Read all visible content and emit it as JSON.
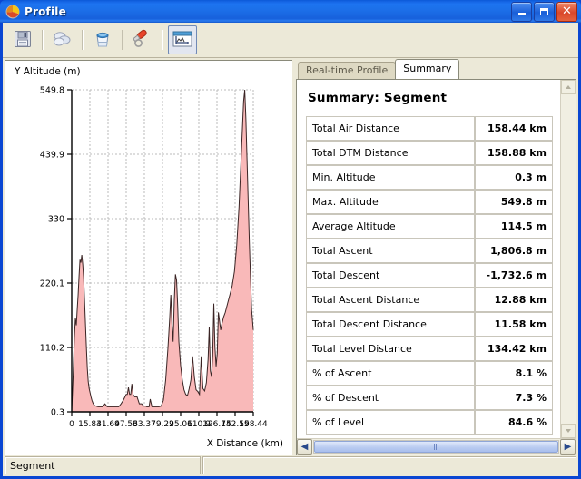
{
  "window": {
    "title": "Profile",
    "icon": "profile-app-icon",
    "caption_buttons": [
      {
        "name": "minimize",
        "glyph": "_"
      },
      {
        "name": "maximize",
        "glyph": "□"
      },
      {
        "name": "close",
        "glyph": "✕"
      }
    ]
  },
  "toolbar": {
    "buttons": [
      {
        "name": "save-icon",
        "tip": "Save"
      },
      {
        "name": "copy-icon",
        "tip": "Copy"
      },
      {
        "name": "paste-bucket-icon",
        "tip": "Paste"
      },
      {
        "name": "eraser-icon",
        "tip": "Erase"
      },
      {
        "name": "profile-chart-icon",
        "tip": "Profile",
        "selected": true
      }
    ]
  },
  "chart_data": {
    "type": "area",
    "title": "",
    "xlabel": "X Distance (km)",
    "ylabel": "Y Altitude (m)",
    "xlim": [
      0,
      158.44
    ],
    "ylim": [
      0.3,
      549.8
    ],
    "grid": true,
    "legend": "none",
    "fill_color": "#f9b9b9",
    "line_color": "#3a2424",
    "y_ticks": [
      "549.8",
      "439.9",
      "330",
      "220.1",
      "110.2",
      "0.3"
    ],
    "y_tick_values": [
      549.8,
      439.9,
      330,
      220.1,
      110.2,
      0.3
    ],
    "x_ticks": [
      "0",
      "15.84",
      "31.69",
      "47.53",
      "63.37",
      "79.22",
      "95.06",
      "110.9",
      "126.75",
      "142.59",
      "158.44"
    ],
    "x_tick_values": [
      0,
      15.84,
      31.69,
      47.53,
      63.37,
      79.22,
      95.06,
      110.9,
      126.75,
      142.59,
      158.44
    ],
    "x": [
      0,
      1.2,
      2.4,
      3.2,
      4.0,
      4.8,
      5.6,
      6.4,
      7.2,
      8.0,
      8.8,
      9.6,
      10.4,
      11.2,
      12.0,
      12.8,
      13.6,
      14.4,
      15.2,
      16.0,
      16.8,
      17.6,
      18.4,
      19.2,
      20.0,
      21.5,
      23.0,
      25.0,
      27.0,
      29.0,
      31.0,
      33.0,
      35.0,
      37.0,
      39.0,
      41.0,
      43.0,
      45.0,
      46.5,
      47.5,
      48.5,
      49.5,
      50.5,
      51.5,
      52.5,
      53.5,
      55.0,
      57.0,
      59.0,
      61.0,
      63.0,
      64.5,
      65.5,
      66.5,
      67.5,
      68.5,
      70.0,
      72.0,
      74.0,
      76.0,
      78.0,
      80.0,
      82.0,
      84.0,
      85.5,
      86.5,
      87.5,
      88.5,
      89.5,
      90.5,
      91.5,
      92.5,
      93.5,
      95.0,
      96.5,
      98.0,
      99.5,
      101.0,
      102.5,
      104.0,
      105.5,
      107.0,
      108.5,
      110.0,
      111.5,
      113.0,
      114.5,
      116.0,
      117.5,
      119.0,
      120.0,
      121.0,
      122.0,
      123.0,
      124.0,
      125.0,
      126.0,
      127.0,
      128.0,
      129.0,
      130.0,
      131.0,
      132.5,
      134.0,
      136.0,
      138.0,
      140.0,
      142.0,
      144.0,
      146.0,
      148.0,
      150.0,
      151.0,
      152.0,
      153.0,
      154.0,
      155.0,
      156.0,
      157.0,
      158.44
    ],
    "y": [
      0.3,
      60,
      130,
      160,
      148,
      175,
      200,
      232,
      260,
      255,
      268,
      252,
      230,
      190,
      150,
      110,
      75,
      52,
      40,
      33,
      26,
      20,
      16,
      13,
      11,
      10,
      9,
      9,
      9,
      14,
      9,
      9,
      9,
      9,
      9,
      9,
      14,
      20,
      26,
      30,
      30,
      42,
      30,
      30,
      48,
      30,
      26,
      26,
      14,
      14,
      10,
      10,
      9,
      9,
      9,
      22,
      9,
      9,
      9,
      9,
      10,
      20,
      55,
      110,
      160,
      200,
      150,
      120,
      190,
      235,
      225,
      180,
      120,
      80,
      55,
      38,
      30,
      28,
      40,
      55,
      95,
      60,
      38,
      35,
      30,
      95,
      40,
      36,
      50,
      90,
      145,
      70,
      60,
      95,
      185,
      110,
      78,
      100,
      170,
      155,
      140,
      150,
      162,
      170,
      185,
      200,
      215,
      240,
      285,
      350,
      440,
      530,
      549.8,
      500,
      430,
      360,
      290,
      230,
      175,
      140,
      115
    ]
  },
  "tabs": [
    {
      "label": "Real-time Profile",
      "active": false
    },
    {
      "label": "Summary",
      "active": true
    }
  ],
  "summary": {
    "heading": "Summary: Segment",
    "rows": [
      {
        "label": "Total Air Distance",
        "value": "158.44 km"
      },
      {
        "label": "Total DTM Distance",
        "value": "158.88 km"
      },
      {
        "label": "Min. Altitude",
        "value": "0.3 m"
      },
      {
        "label": "Max. Altitude",
        "value": "549.8 m"
      },
      {
        "label": "Average Altitude",
        "value": "114.5 m"
      },
      {
        "label": "Total Ascent",
        "value": "1,806.8 m"
      },
      {
        "label": "Total Descent",
        "value": "-1,732.6 m"
      },
      {
        "label": "Total Ascent Distance",
        "value": "12.88 km"
      },
      {
        "label": "Total Descent Distance",
        "value": "11.58 km"
      },
      {
        "label": "Total Level Distance",
        "value": "134.42 km"
      },
      {
        "label": "% of Ascent",
        "value": "8.1 %"
      },
      {
        "label": "% of Descent",
        "value": "7.3 %"
      },
      {
        "label": "% of Level",
        "value": "84.6 %"
      }
    ]
  },
  "scrollbars": {
    "vertical": {
      "up": "▲",
      "down": "▼"
    },
    "horizontal": {
      "left": "◀",
      "right": "▶"
    }
  },
  "statusbar": {
    "panel1": "Segment",
    "panel2": ""
  }
}
